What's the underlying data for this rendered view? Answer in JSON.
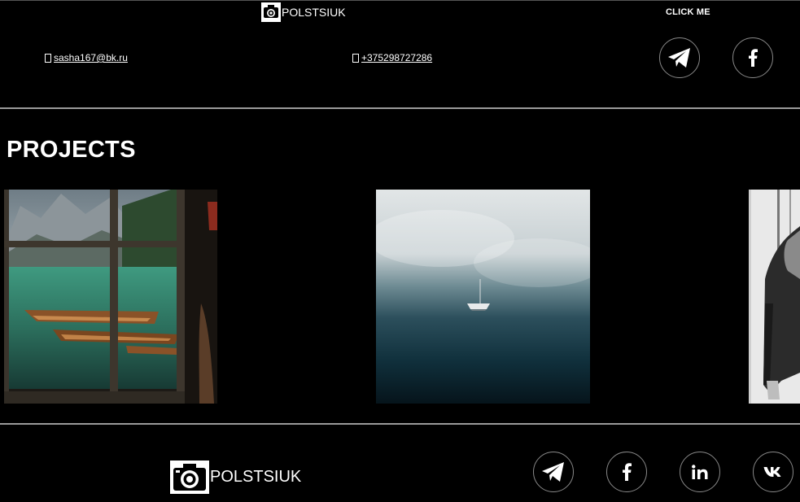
{
  "header": {
    "brand": "POLSTSIUK",
    "cta_label": "CLICK ME",
    "email": " sasha167@bk.ru",
    "phone": " +375298727286",
    "email_icon": "envelope-icon",
    "phone_icon": "phone-icon",
    "social": [
      "telegram-icon",
      "facebook-icon"
    ]
  },
  "main": {
    "title": "PROJECTS",
    "projects": [
      {
        "name": "mountain-lake-window-boats"
      },
      {
        "name": "sailboat-in-fog"
      },
      {
        "name": "man-in-leather-jacket"
      }
    ]
  },
  "footer": {
    "brand": "POLSTSIUK",
    "social": [
      "telegram-icon",
      "facebook-icon",
      "linkedin-icon",
      "vk-icon"
    ]
  },
  "colors": {
    "background": "#000000",
    "text": "#ffffff",
    "divider": "#9a9a9a",
    "circle_border": "#888888"
  }
}
